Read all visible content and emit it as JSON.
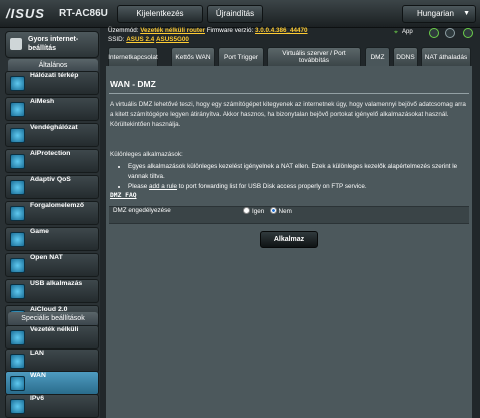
{
  "header": {
    "brand": "/ISUS",
    "model": "RT-AC86U",
    "logout_label": "Kijelentkezés",
    "reboot_label": "Újraindítás",
    "language": "Hungarian"
  },
  "info": {
    "mode_label": "Üzemmód:",
    "mode_value": "Vezeték nélküli router",
    "firmware_label": "Firmware verzió:",
    "firmware_value": "3.0.0.4.386_44470",
    "ssid_label": "SSID:",
    "ssid_1": "ASUS 2.4",
    "ssid_2": "ASUS5G00",
    "app_label": "App"
  },
  "sidebar": {
    "quick_setup": "Gyors internet-beállítás",
    "general_header": "Általános",
    "general_items": [
      {
        "label": "Hálózati térkép",
        "icon": "network-map-icon"
      },
      {
        "label": "AiMesh",
        "icon": "aimesh-icon"
      },
      {
        "label": "Vendéghálózat",
        "icon": "guest-network-icon"
      },
      {
        "label": "AiProtection",
        "icon": "shield-icon"
      },
      {
        "label": "Adaptív QoS",
        "icon": "qos-icon"
      },
      {
        "label": "Forgalomelemző",
        "icon": "traffic-analyzer-icon"
      },
      {
        "label": "Game",
        "icon": "game-icon"
      },
      {
        "label": "Open NAT",
        "icon": "open-nat-icon"
      },
      {
        "label": "USB alkalmazás",
        "icon": "usb-icon"
      },
      {
        "label": "AiCloud 2.0",
        "icon": "cloud-icon"
      }
    ],
    "advanced_header": "Speciális beállítások",
    "advanced_items": [
      {
        "label": "Vezeték nélküli",
        "icon": "wireless-icon"
      },
      {
        "label": "LAN",
        "icon": "lan-icon"
      },
      {
        "label": "WAN",
        "icon": "wan-icon"
      },
      {
        "label": "IPv6",
        "icon": "ipv6-icon"
      }
    ]
  },
  "tabs": [
    "Internetkapcsolat",
    "Kettős WAN",
    "Port Trigger",
    "Virtuális szerver / Port továbbítás",
    "DMZ",
    "DDNS",
    "NAT áthaladás"
  ],
  "active_tab": "DMZ",
  "content": {
    "title": "WAN - DMZ",
    "description": "A virtuális DMZ lehetővé teszi, hogy egy számítógépet kitegyenek az internetnek úgy, hogy valamennyi bejövő adatcsomag arra a kitett számítógépre legyen átirányítva. Akkor hasznos, ha bizonytalan bejövő portokat igényelő alkalmazásokat használ. Körültekintően használja.",
    "special_title": "Különleges alkalmazások:",
    "bullet1": "Egyes alkalmazások különleges kezelést igényelnek a NAT ellen. Ezek a különleges kezelők alapértelmezés szerint le vannak tiltva.",
    "bullet2_prefix": "Please ",
    "bullet2_link": "add a rule",
    "bullet2_suffix": " to port forwarding list for USB Disk access properly on FTP service.",
    "faq": "DMZ FAQ",
    "dmz_label": "DMZ engedélyezése",
    "option_yes": "Igen",
    "option_no": "Nem",
    "selected": "Nem",
    "apply": "Alkalmaz"
  },
  "colors": {
    "accent_active": "#3c86ad",
    "link_yellow": "#ffcc33",
    "background": "#21272a"
  }
}
